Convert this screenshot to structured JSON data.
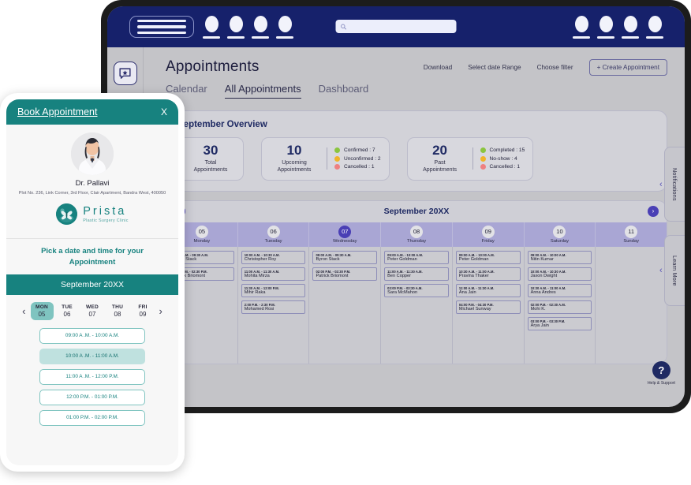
{
  "desktop": {
    "topbar": {
      "menu_icon": "hamburger-icon",
      "search_icon": "search-icon",
      "search_placeholder": "",
      "left_nav_count": 4,
      "right_nav_count": 4
    },
    "rail": {
      "items": [
        {
          "icon": "star-message-icon",
          "name": "reviews"
        },
        {
          "icon": "trending-chart-icon",
          "name": "analytics"
        }
      ]
    },
    "header": {
      "title": "Appointments",
      "actions": [
        "Download",
        "Select date Range",
        "Choose filter"
      ],
      "create_button": "+ Create Appointment"
    },
    "tabs": [
      {
        "label": "Calendar",
        "active": false
      },
      {
        "label": "All Appointments",
        "active": true
      },
      {
        "label": "Dashboard",
        "active": false
      }
    ],
    "overview": {
      "title": "September Overview",
      "cards": [
        {
          "number": "30",
          "label": "Total\nAppointments",
          "legend": []
        },
        {
          "number": "10",
          "label": "Upcoming\nAppointments",
          "legend": [
            {
              "text": "Confirmed  : 7",
              "color": "#8bc53f"
            },
            {
              "text": "Unconfirmed : 2",
              "color": "#f0b429"
            },
            {
              "text": "Cancelled : 1",
              "color": "#ef8080"
            }
          ]
        },
        {
          "number": "20",
          "label": "Past\nAppointments",
          "legend": [
            {
              "text": "Completed : 15",
              "color": "#8bc53f"
            },
            {
              "text": "No-show : 4",
              "color": "#f0b429"
            },
            {
              "text": "Cancelled : 1",
              "color": "#ef8080"
            }
          ]
        }
      ]
    },
    "calendar": {
      "month": "September 20XX",
      "prev_icon": "chevron-left-icon",
      "next_icon": "chevron-right-icon",
      "days": [
        {
          "num": "05",
          "name": "Monday",
          "today": false
        },
        {
          "num": "06",
          "name": "Tuesday",
          "today": false
        },
        {
          "num": "07",
          "name": "Wednesday",
          "today": true
        },
        {
          "num": "08",
          "name": "Thursday",
          "today": false
        },
        {
          "num": "09",
          "name": "Friday",
          "today": false
        },
        {
          "num": "10",
          "name": "Saturday",
          "today": false
        },
        {
          "num": "11",
          "name": "Sunday",
          "today": false
        }
      ],
      "columns": [
        [
          {
            "time": "09:00 A.M. - 09:30 A.M.",
            "name": "Byron Stack"
          },
          {
            "time": "02:00 P.M. - 02:30 P.M.",
            "name": "Patrick Briomont"
          }
        ],
        [
          {
            "time": "10:00 A.M. - 10:30 A.M.",
            "name": "Christopher Roy"
          },
          {
            "time": "11:00 A.M. - 11:30 A.M.",
            "name": "Mohita Mirza"
          },
          {
            "time": "11:30 A.M. - 12:00 P.M.",
            "name": "Mihir Raka"
          },
          {
            "time": "2:00 P.M. - 2:30 P.M.",
            "name": "Mohamed Rosi"
          }
        ],
        [
          {
            "time": "09:00 A.M. - 09:30 A.M.",
            "name": "Byron Stack"
          },
          {
            "time": "02:00 P.M. - 02:30 P.M.",
            "name": "Patrick Briomont"
          }
        ],
        [
          {
            "time": "09:00 A.M. - 10:00 A.M.",
            "name": "Peter Goldman"
          },
          {
            "time": "11:00 A.M. - 11:30 A.M.",
            "name": "Ben Copper"
          },
          {
            "time": "03:00 P.M. - 03:30 A.M.",
            "name": "Sara McMahon"
          }
        ],
        [
          {
            "time": "09:00 A.M. - 10:00 A.M.",
            "name": "Peter Goldman"
          },
          {
            "time": "10:30 A.M. - 11:00 A.M.",
            "name": "Pravina Thaker"
          },
          {
            "time": "11:00 A.M. - 11:30 A.M.",
            "name": "Ana Jain"
          },
          {
            "time": "04:00 P.M. - 04:30 P.M.",
            "name": "Michael Sunway"
          }
        ],
        [
          {
            "time": "09:00 A.M. - 10:00 A.M.",
            "name": "Nitin Kumar"
          },
          {
            "time": "10:00 A.M. - 10:30 A.M.",
            "name": "Jaxon Dwight"
          },
          {
            "time": "10:30 A.M. - 11:00 A.M.",
            "name": "Anna Andres"
          },
          {
            "time": "02:00 P.M. - 02:30 A.M.",
            "name": "Mohi K."
          },
          {
            "time": "03:00 P.M. - 03:30 P.M.",
            "name": "Arya Jain"
          }
        ],
        []
      ]
    },
    "side_tabs": [
      {
        "label": "Notifications",
        "icon": "chevron-left-icon"
      },
      {
        "label": "Learn More",
        "icon": "chevron-left-icon"
      }
    ],
    "help": {
      "icon": "question-mark-icon",
      "label": "Help & Support"
    }
  },
  "phone": {
    "modal": {
      "title": "Book Appointment",
      "close_label": "X"
    },
    "doctor": {
      "name": "Dr. Pallavi",
      "address": "Plot No. 236, Link Corner, 3rd Floor, Clair Apartment, Bandra West, 400050",
      "photo": "doctor-avatar"
    },
    "clinic": {
      "name": "Prista",
      "tagline": "Plastic Surgery Clinic",
      "logo": "butterfly-logo-icon",
      "accent": "#17827f"
    },
    "pick_prompt": "Pick a date and time for your Appointment",
    "month": "September 20XX",
    "daystrip": {
      "prev_icon": "chevron-left-icon",
      "next_icon": "chevron-right-icon",
      "days": [
        {
          "dow": "MON",
          "num": "05",
          "selected": true
        },
        {
          "dow": "TUE",
          "num": "06",
          "selected": false
        },
        {
          "dow": "WED",
          "num": "07",
          "selected": false
        },
        {
          "dow": "THU",
          "num": "08",
          "selected": false
        },
        {
          "dow": "FRI",
          "num": "09",
          "selected": false
        }
      ]
    },
    "slots": [
      {
        "label": "09:00 A .M. - 10:00 A.M.",
        "selected": false
      },
      {
        "label": "10:00 A .M. - 11:00 A.M.",
        "selected": true
      },
      {
        "label": "11:00 A .M. - 12:00 P.M.",
        "selected": false
      },
      {
        "label": "12:00 P.M. - 01:00 P.M.",
        "selected": false
      },
      {
        "label": "01:00 P.M. - 02:00 P.M.",
        "selected": false
      }
    ]
  }
}
